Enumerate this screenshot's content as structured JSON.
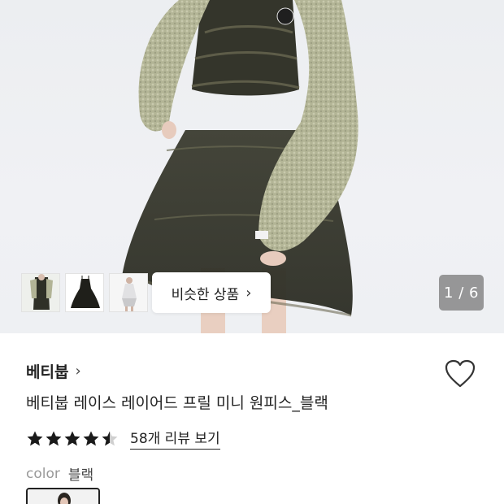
{
  "gallery": {
    "similar_label": "비슷한 상품",
    "similar_chevron": "›",
    "pager": "1 / 6",
    "thumbnails": [
      "product-photo-cardigan",
      "product-photo-dress",
      "product-photo-model"
    ]
  },
  "product": {
    "brand": "베티붑",
    "brand_chevron": "›",
    "name": "베티붑 레이스 레이어드 프릴 미니 원피스_블랙",
    "rating": 4.5,
    "stars_max": 5,
    "review_link": "58개 리뷰 보기",
    "color_label": "color",
    "color_value": "블랙",
    "wishlist_icon": "heart-outline-icon"
  },
  "colors": {
    "accent": "#111111",
    "star": "#1a1a1a",
    "pager_bg": "#7a7a7a",
    "cardigan": "#b6b79a",
    "dress": "#3a3a2e"
  }
}
